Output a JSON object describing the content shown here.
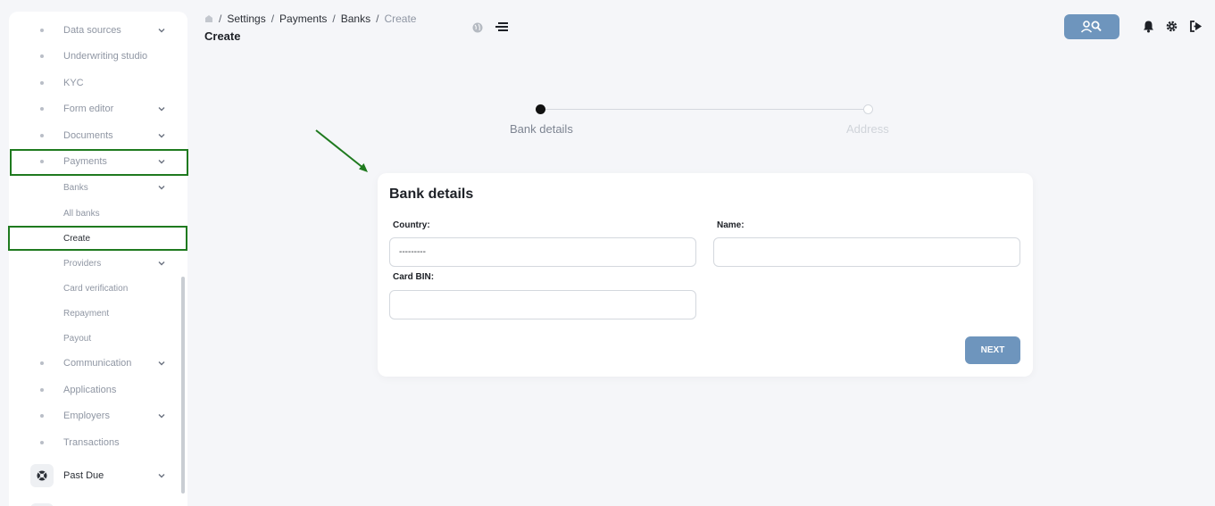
{
  "sidebar": {
    "items": [
      {
        "label": "Data sources",
        "has_chevron": true
      },
      {
        "label": "Underwriting studio",
        "has_chevron": false
      },
      {
        "label": "KYC",
        "has_chevron": false
      },
      {
        "label": "Form editor",
        "has_chevron": true
      },
      {
        "label": "Documents",
        "has_chevron": true
      },
      {
        "label": "Payments",
        "has_chevron": true
      },
      {
        "label": "Banks",
        "has_chevron": true
      },
      {
        "label": "All banks",
        "has_chevron": false
      },
      {
        "label": "Create",
        "has_chevron": false
      },
      {
        "label": "Providers",
        "has_chevron": true
      },
      {
        "label": "Card verification",
        "has_chevron": false
      },
      {
        "label": "Repayment",
        "has_chevron": false
      },
      {
        "label": "Payout",
        "has_chevron": false
      },
      {
        "label": "Communication",
        "has_chevron": true
      },
      {
        "label": "Applications",
        "has_chevron": false
      },
      {
        "label": "Employers",
        "has_chevron": true
      },
      {
        "label": "Transactions",
        "has_chevron": false
      },
      {
        "label": "Past Due",
        "has_chevron": true
      }
    ]
  },
  "header": {
    "breadcrumb": [
      "Settings",
      "Payments",
      "Banks",
      "Create"
    ],
    "title": "Create"
  },
  "stepper": {
    "steps": [
      {
        "label": "Bank details",
        "active": true
      },
      {
        "label": "Address",
        "active": false
      }
    ]
  },
  "form": {
    "title": "Bank details",
    "country_label": "Country:",
    "country_placeholder": "---------",
    "name_label": "Name:",
    "name_value": "",
    "card_bin_label": "Card BIN:",
    "card_bin_value": "",
    "next_label": "NEXT"
  },
  "colors": {
    "accent": "#6e95bd",
    "highlight": "#1f7a1f"
  }
}
